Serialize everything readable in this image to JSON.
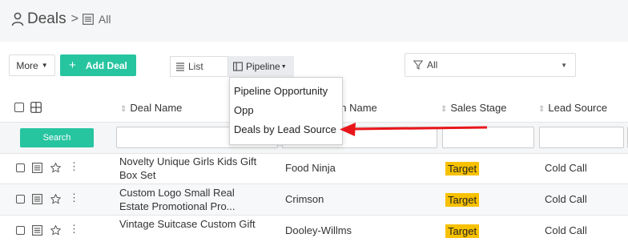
{
  "header": {
    "title": "Deals",
    "separator": ">",
    "sub": "All"
  },
  "toolbar": {
    "more_label": "More",
    "add_label": "Add Deal",
    "view_list_label": "List",
    "view_pipeline_label": "Pipeline",
    "filter_label": "All"
  },
  "pipeline_menu": {
    "items": [
      "Pipeline Opportunity",
      "Opp",
      "Deals by Lead Source"
    ],
    "highlighted_index": 2
  },
  "table": {
    "columns": [
      "Deal Name",
      "on Name",
      "Sales Stage",
      "Lead Source"
    ],
    "search_label": "Search",
    "rows": [
      {
        "name": "Novelty Unique Girls Kids Gift Box Set",
        "account": "Food Ninja",
        "stage": "Target",
        "lead": "Cold Call"
      },
      {
        "name": "Custom Logo Small Real Estate Promotional Pro...",
        "account": "Crimson",
        "stage": "Target",
        "lead": "Cold Call"
      },
      {
        "name": "Vintage Suitcase Custom Gift",
        "account": "Dooley-Willms",
        "stage": "Target",
        "lead": "Cold Call"
      }
    ]
  },
  "colors": {
    "accent": "#27c4a0",
    "stage_badge": "#f7c100",
    "arrow": "#e8161b"
  },
  "icons": [
    "user-icon",
    "list-icon",
    "caret-down-icon",
    "plus-icon",
    "pipeline-icon",
    "funnel-icon",
    "grid-icon",
    "sort-icon",
    "document-icon",
    "star-icon",
    "more-vertical-icon",
    "arrow-left-icon"
  ]
}
